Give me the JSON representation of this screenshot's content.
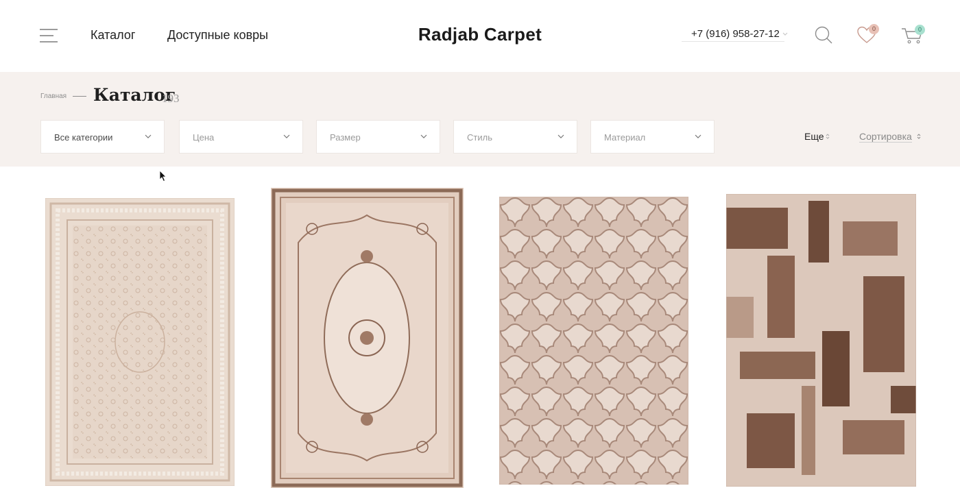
{
  "header": {
    "nav": {
      "catalog": "Каталог",
      "affordable": "Доступные ковры"
    },
    "logo": "Radjab Carpet",
    "phone": "+7 (916) 958-27-12",
    "favorites_count": "0",
    "cart_count": "0"
  },
  "breadcrumb": {
    "home": "Главная"
  },
  "page": {
    "title": "Каталог",
    "count": "193"
  },
  "filters": [
    {
      "label": "Все категории"
    },
    {
      "label": "Цена"
    },
    {
      "label": "Размер"
    },
    {
      "label": "Стиль"
    },
    {
      "label": "Материал"
    }
  ],
  "controls": {
    "more": "Еще",
    "sort": "Сортировка"
  },
  "icons": {
    "menu": "burger-menu-icon",
    "search": "search-icon",
    "favorites": "heart-icon",
    "cart": "cart-icon",
    "dropdown": "chevron-down-icon",
    "sort": "up-down-arrows-icon"
  },
  "colors": {
    "band_background": "#f6f1ee",
    "favorites_badge": "#e8c1b6",
    "cart_badge": "#a8e0cf",
    "text_primary": "#222222",
    "text_muted": "#9a9a9a"
  }
}
